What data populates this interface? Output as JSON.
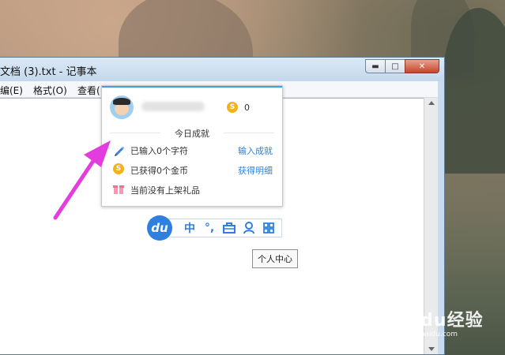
{
  "window": {
    "title": "文档 (3).txt - 记事本",
    "controls": {
      "minimize": "▬",
      "maximize": "□",
      "close": "✕"
    },
    "menu": [
      "编(E)",
      "格式(O)",
      "查看("
    ]
  },
  "popup": {
    "coin_count": "0",
    "section_title": "今日成就",
    "rows": [
      {
        "text": "已输入0个字符",
        "link": "输入成就",
        "icon": "pencil-icon"
      },
      {
        "text": "已获得0个金币",
        "link": "获得明细",
        "icon": "coin-icon"
      },
      {
        "text": "当前没有上架礼品",
        "link": "",
        "icon": "gift-icon"
      }
    ]
  },
  "toolbar": {
    "logo": "du",
    "items": [
      "中",
      "°,",
      "toolbox-icon",
      "user-icon",
      "grid-icon"
    ]
  },
  "tooltip": {
    "text": "个人中心"
  },
  "watermark": {
    "brand": "Baidu经验",
    "url": "jingyan.baidu.com"
  },
  "colors": {
    "accent": "#2f7fdf",
    "link": "#2e7fd3",
    "coin": "#f2b318",
    "arrow": "#e43ddf"
  }
}
